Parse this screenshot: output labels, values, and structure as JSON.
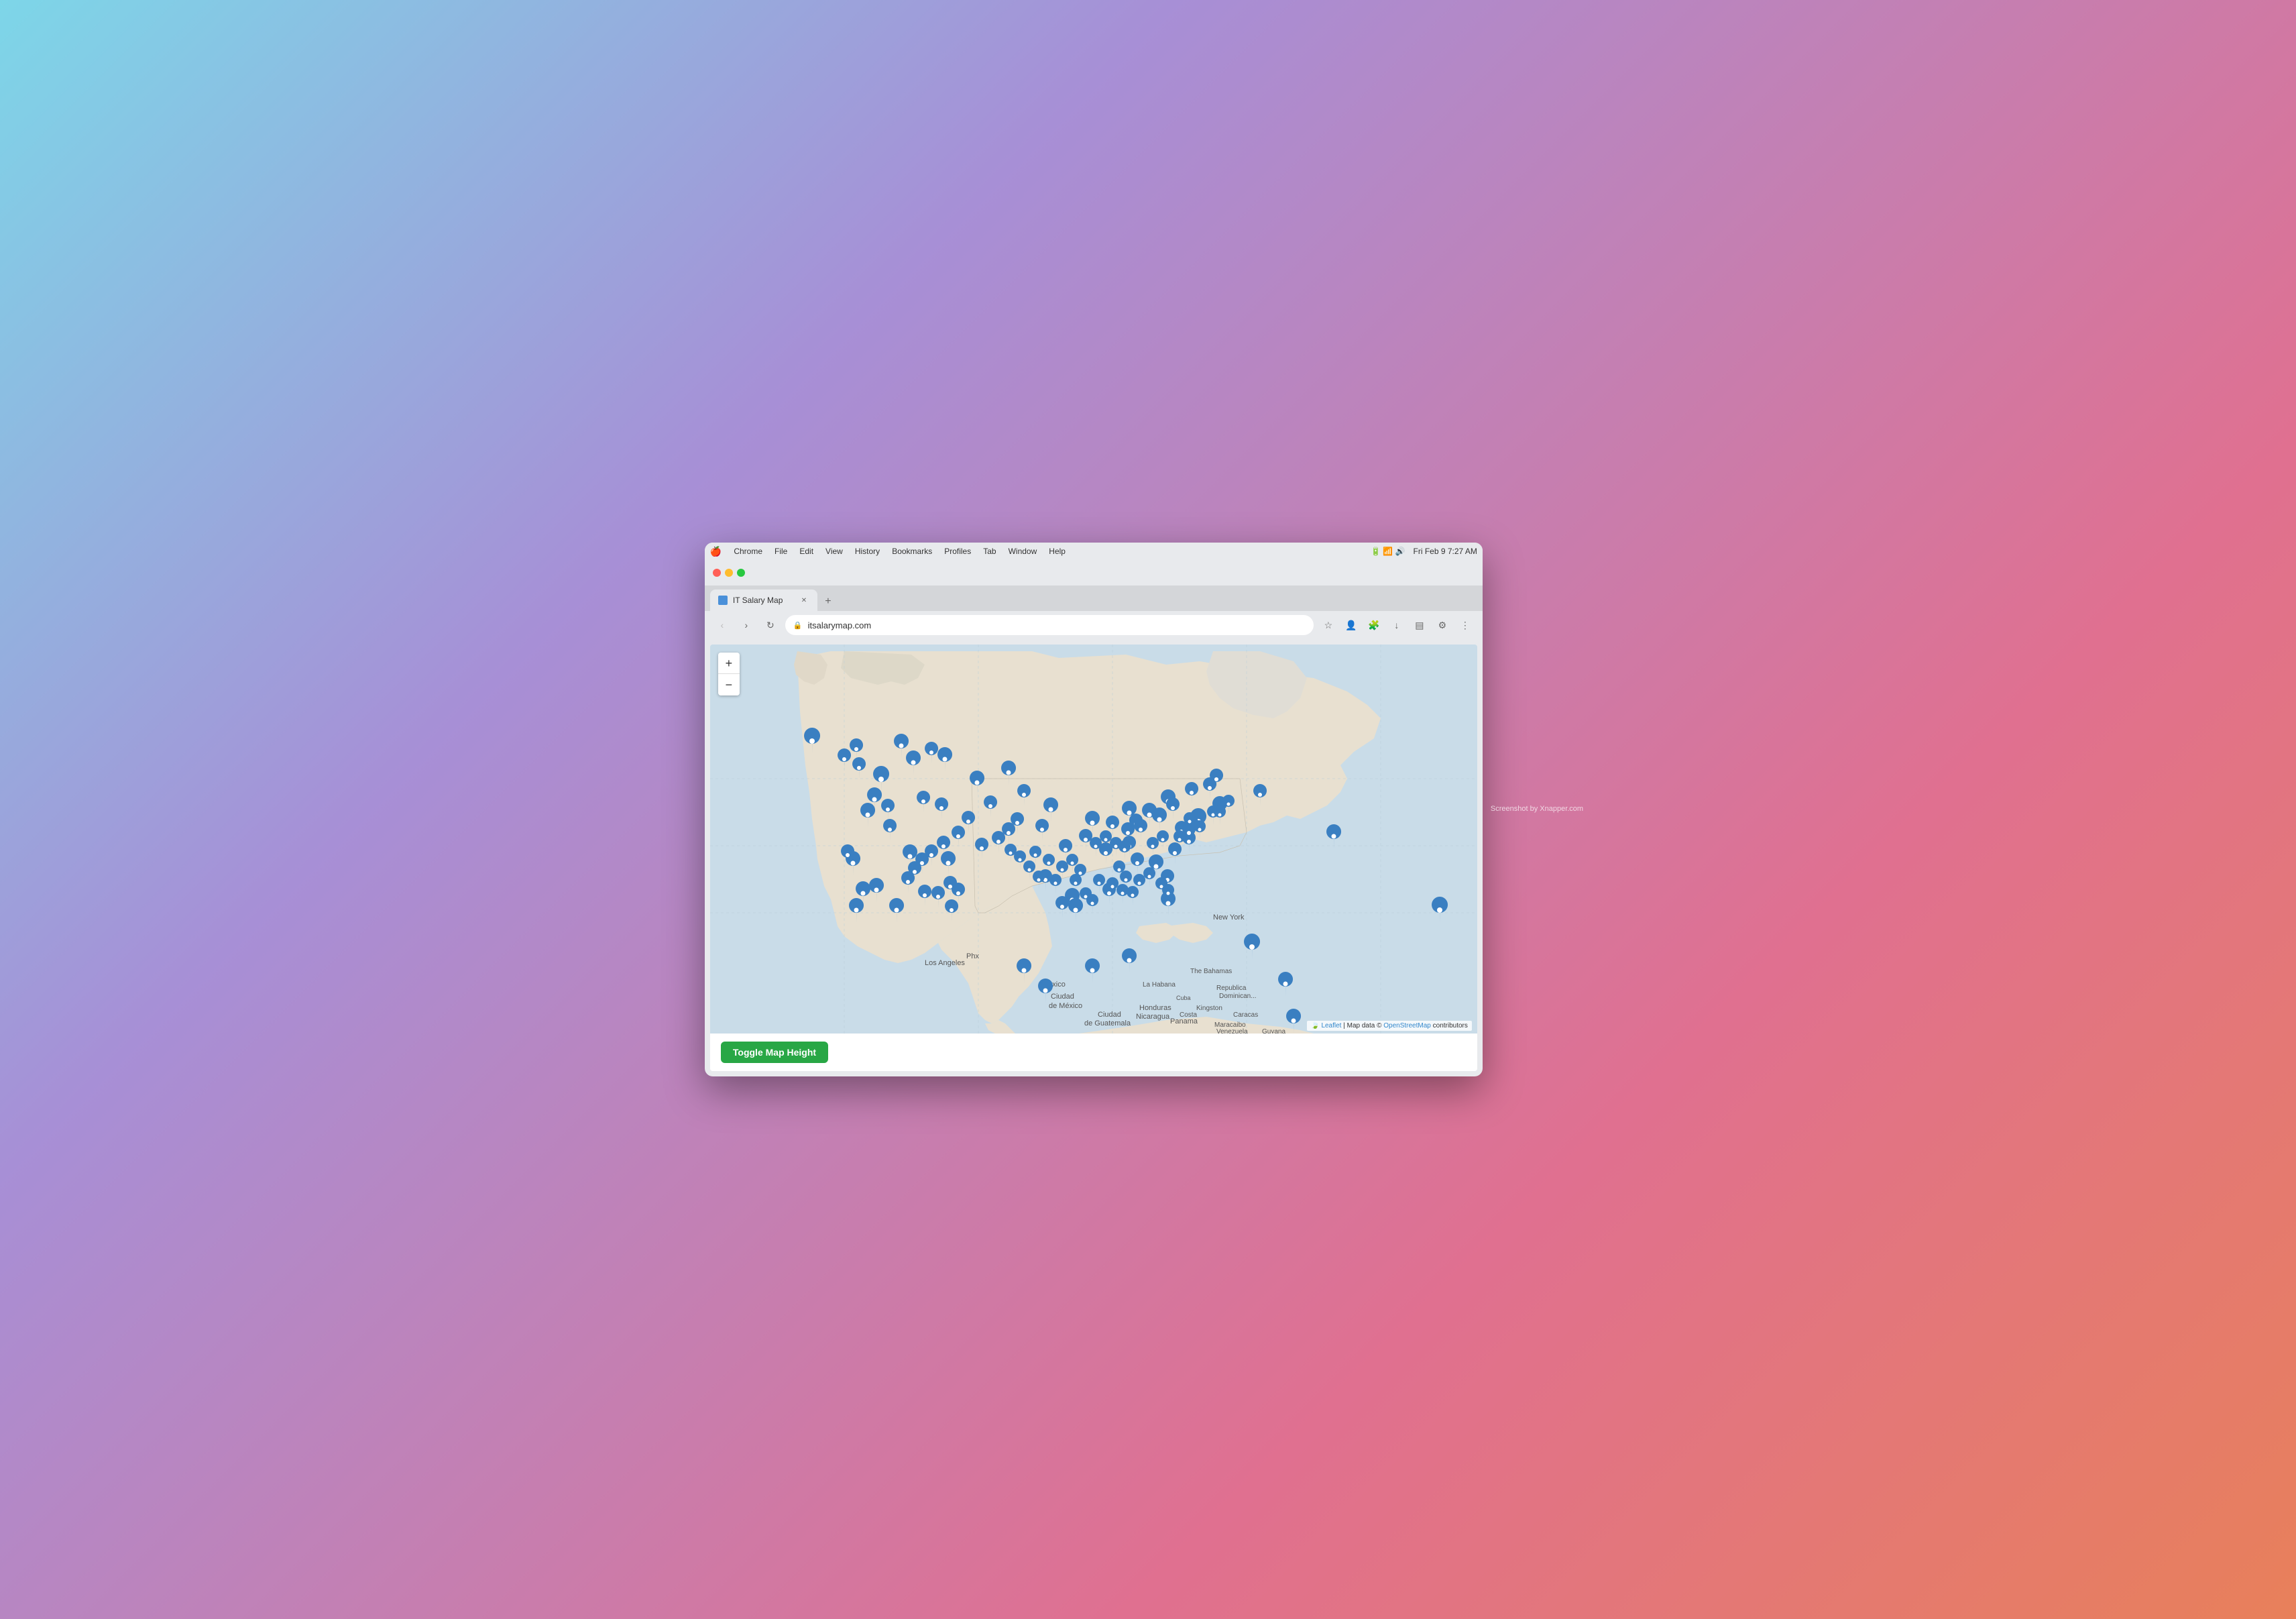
{
  "browser": {
    "title": "IT Salary Map",
    "url": "itsalarymap.com",
    "tab_label": "IT Salary Map",
    "time": "Fri Feb 9  7:27 AM",
    "menu_items": [
      "Chrome",
      "File",
      "Edit",
      "View",
      "History",
      "Bookmarks",
      "Profiles",
      "Tab",
      "Window",
      "Help"
    ]
  },
  "map": {
    "zoom_in": "+",
    "zoom_out": "−",
    "attribution_prefix": "Leaflet",
    "attribution_map": "| Map data © ",
    "attribution_osm": "OpenStreetMap",
    "attribution_suffix": " contributors"
  },
  "controls": {
    "toggle_button": "Toggle Map Height"
  },
  "watermark": "Screenshot by Xnapper.com"
}
